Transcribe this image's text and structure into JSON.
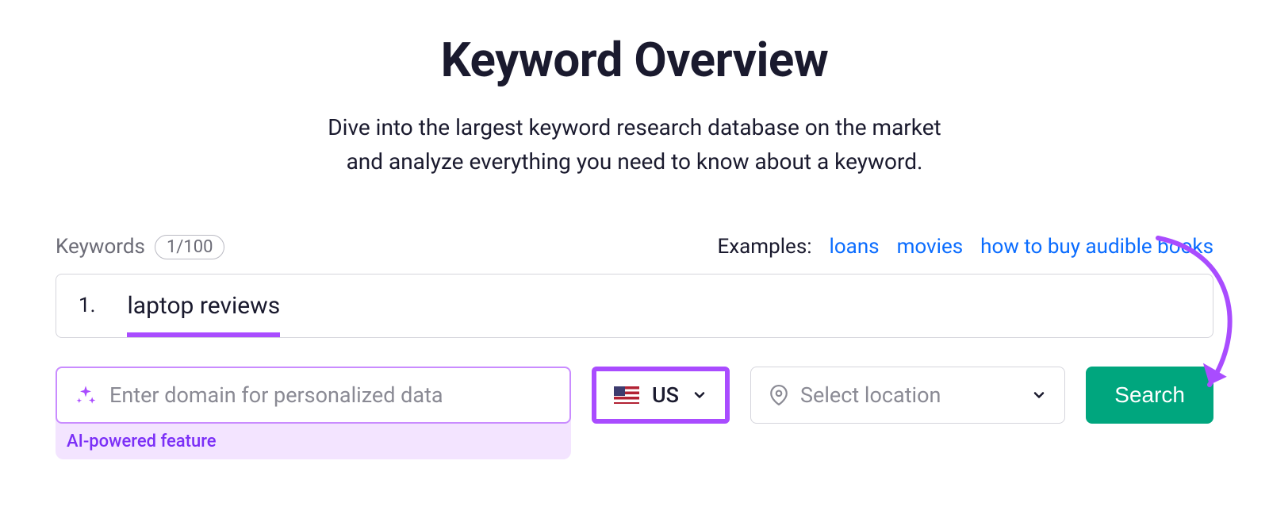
{
  "header": {
    "title": "Keyword Overview",
    "subtitle_line1": "Dive into the largest keyword research database on the market",
    "subtitle_line2": "and analyze everything you need to know about a keyword."
  },
  "form": {
    "keywords_label": "Keywords",
    "count": "1/100",
    "examples_label": "Examples:",
    "example_links": [
      "loans",
      "movies",
      "how to buy audible books"
    ],
    "keyword_row": {
      "number": "1.",
      "value": "laptop reviews"
    },
    "domain": {
      "placeholder": "Enter domain for personalized data",
      "ai_caption": "AI-powered feature"
    },
    "country": {
      "code": "US"
    },
    "location": {
      "placeholder": "Select location"
    },
    "search_label": "Search"
  }
}
